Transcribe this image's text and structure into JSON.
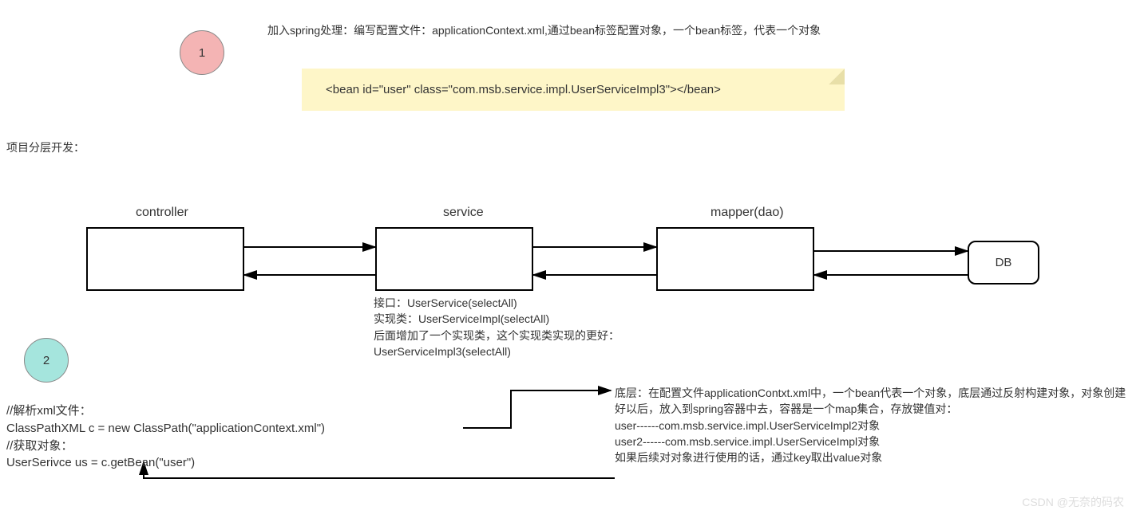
{
  "step1": {
    "num": "1",
    "desc": "加入spring处理：编写配置文件：applicationContext.xml,通过bean标签配置对象，一个bean标签，代表一个对象",
    "code": "<bean id=\"user\" class=\"com.msb.service.impl.UserServiceImpl3\"></bean>"
  },
  "sectionLabel": "项目分层开发：",
  "tiers": {
    "controller": "controller",
    "service": "service",
    "mapper": "mapper(dao)",
    "db": "DB"
  },
  "serviceNotes": {
    "l1": "接口：UserService(selectAll)",
    "l2": "实现类：UserServiceImpl(selectAll)",
    "l3": "后面增加了一个实现类，这个实现类实现的更好：",
    "l4": "UserServiceImpl3(selectAll)"
  },
  "step2": {
    "num": "2",
    "codeLine1": "//解析xml文件：",
    "codeLine2": "ClassPathXML c = new ClassPath(\"applicationContext.xml\")",
    "codeLine3": "//获取对象：",
    "codeLine4": "UserSerivce us = c.getBean(\"user\")"
  },
  "bottomRight": {
    "l1": "底层：在配置文件applicationContxt.xml中，一个bean代表一个对象，底层通过反射构建对象，对象创建好以后，放入到spring容器中去，容器是一个map集合，存放键值对：",
    "l2": "user------com.msb.service.impl.UserServiceImpl2对象",
    "l3": "user2------com.msb.service.impl.UserServiceImpl对象",
    "l4": "如果后续对对象进行使用的话，通过key取出value对象"
  },
  "watermark": "CSDN @无奈的码农"
}
